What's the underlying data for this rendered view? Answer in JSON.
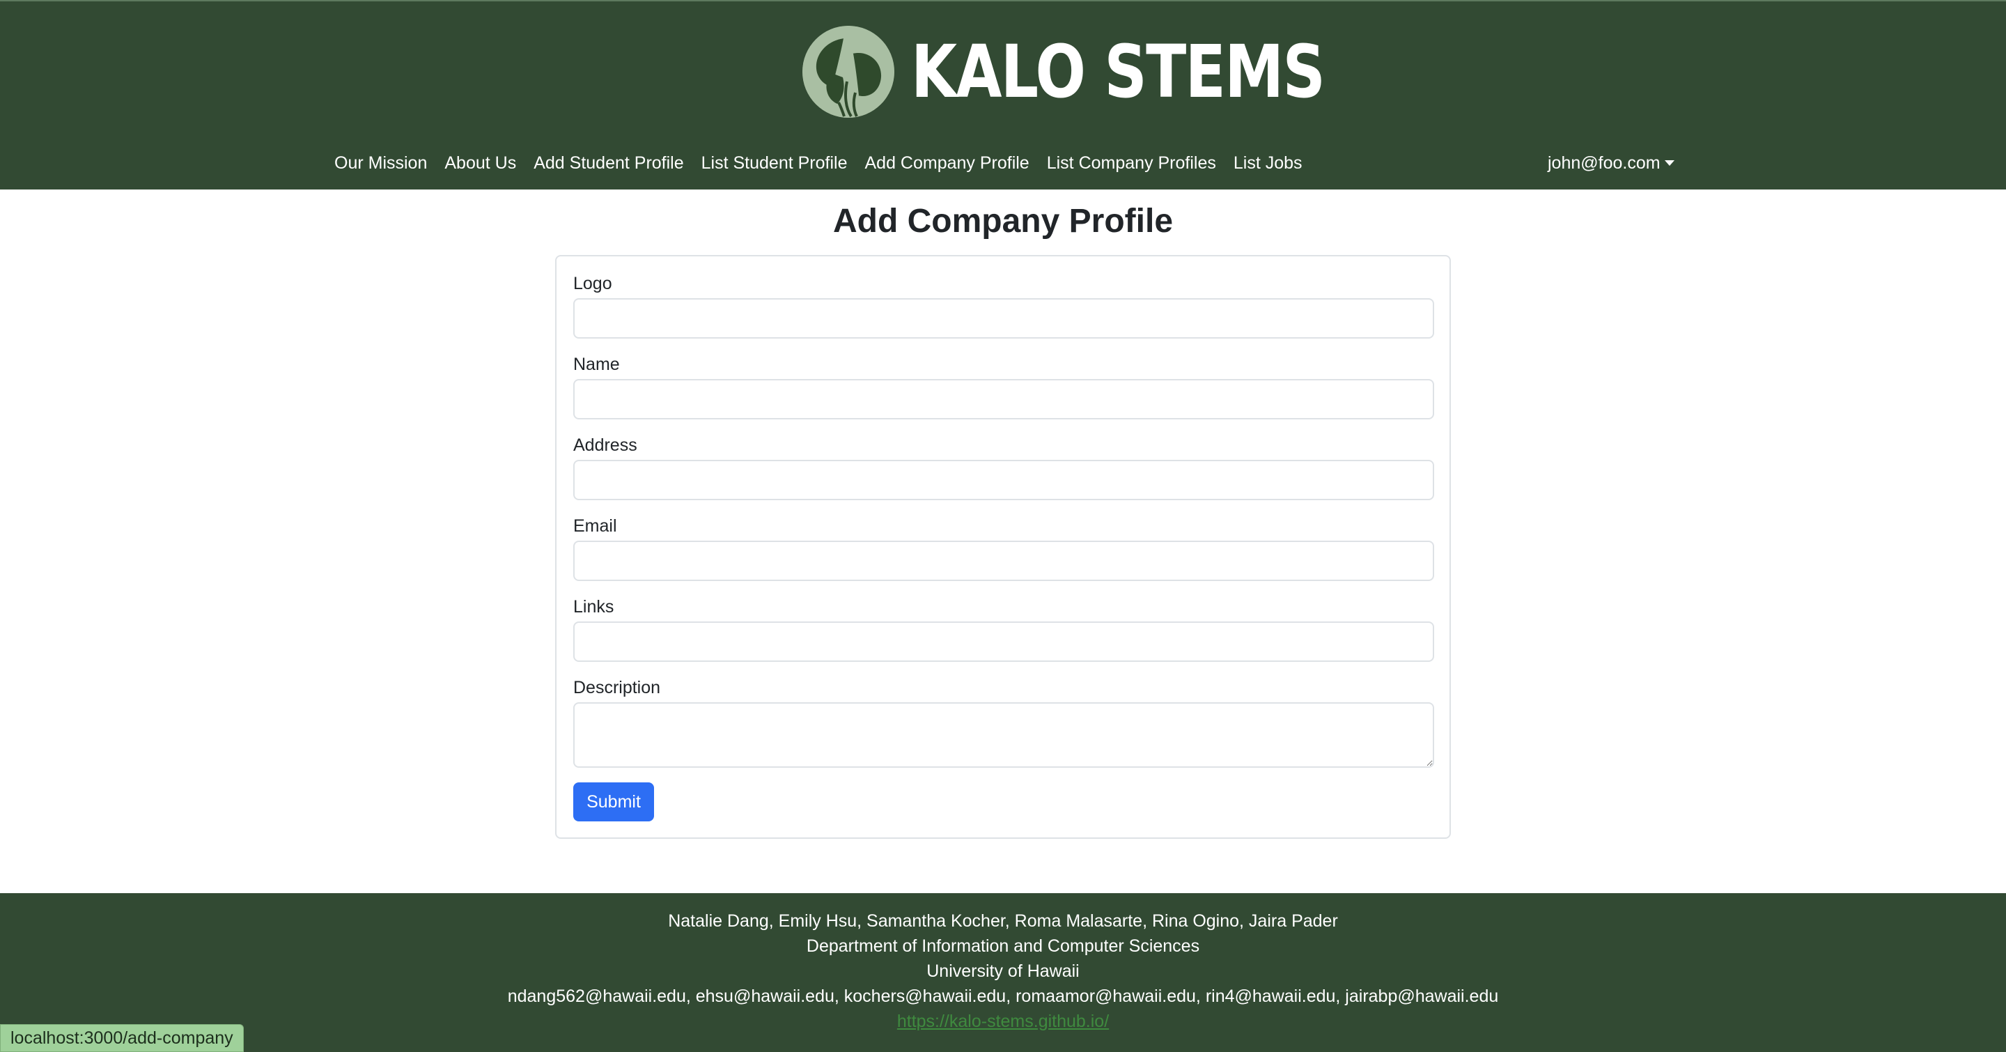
{
  "brand": {
    "name": "KALO STEMS",
    "logo_icon": "taro-leaf-logo-icon"
  },
  "nav": {
    "links": [
      "Our Mission",
      "About Us",
      "Add Student Profile",
      "List Student Profile",
      "Add Company Profile",
      "List Company Profiles",
      "List Jobs"
    ],
    "user": "john@foo.com",
    "user_icon": "caret-down-icon"
  },
  "page": {
    "title": "Add Company Profile"
  },
  "form": {
    "fields": [
      {
        "label": "Logo",
        "value": ""
      },
      {
        "label": "Name",
        "value": ""
      },
      {
        "label": "Address",
        "value": ""
      },
      {
        "label": "Email",
        "value": ""
      },
      {
        "label": "Links",
        "value": ""
      },
      {
        "label": "Description",
        "value": ""
      }
    ],
    "submit_label": "Submit"
  },
  "footer": {
    "names": "Natalie Dang, Emily Hsu, Samantha Kocher, Roma Malasarte, Rina Ogino, Jaira Pader",
    "department": "Department of Information and Computer Sciences",
    "university": "University of Hawaii",
    "emails": "ndang562@hawaii.edu, ehsu@hawaii.edu, kochers@hawaii.edu, romaamor@hawaii.edu, rin4@hawaii.edu, jairabp@hawaii.edu",
    "link": "https://kalo-stems.github.io/"
  },
  "status_bar": {
    "url": "localhost:3000/add-company"
  },
  "colors": {
    "header_bg": "#324a33",
    "primary_button": "#2d6ef4",
    "footer_link": "#3f8a3f"
  }
}
